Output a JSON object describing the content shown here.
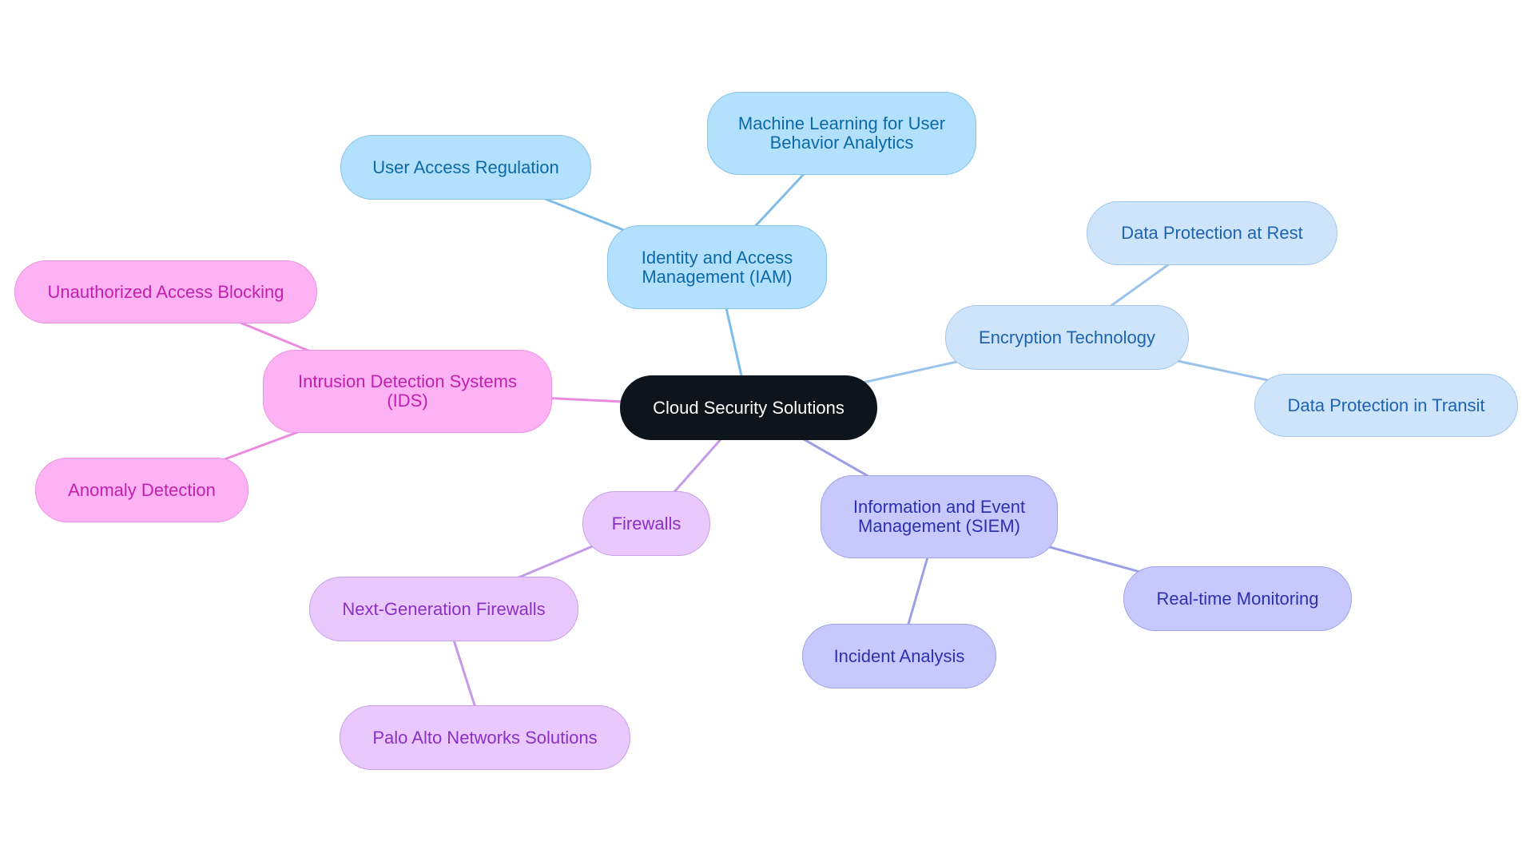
{
  "title": "Cloud Security Solutions",
  "colors": {
    "root": "#0d141c",
    "iam": "#7fbde8",
    "encryption": "#9bc3ea",
    "siem": "#9c9fe6",
    "firewalls": "#c59ae8",
    "ids": "#ea8be0"
  },
  "nodes": {
    "root": "Cloud Security Solutions",
    "iam": "Identity and Access\nManagement (IAM)",
    "iam_user_access": "User Access Regulation",
    "iam_ml": "Machine Learning for User\nBehavior Analytics",
    "enc": "Encryption Technology",
    "enc_rest": "Data Protection at Rest",
    "enc_transit": "Data Protection in Transit",
    "ids": "Intrusion Detection Systems\n(IDS)",
    "ids_unauth": "Unauthorized Access Blocking",
    "ids_anomaly": "Anomaly Detection",
    "fw": "Firewalls",
    "fw_ngfw": "Next-Generation Firewalls",
    "fw_palo": "Palo Alto Networks Solutions",
    "siem": "Information and Event\nManagement (SIEM)",
    "siem_realtime": "Real-time Monitoring",
    "siem_incident": "Incident Analysis"
  },
  "edges": [
    {
      "from": "root",
      "to": "iam",
      "branch": "iam"
    },
    {
      "from": "iam",
      "to": "iam_user_access",
      "branch": "iam"
    },
    {
      "from": "iam",
      "to": "iam_ml",
      "branch": "iam"
    },
    {
      "from": "root",
      "to": "enc",
      "branch": "encryption"
    },
    {
      "from": "enc",
      "to": "enc_rest",
      "branch": "encryption"
    },
    {
      "from": "enc",
      "to": "enc_transit",
      "branch": "encryption"
    },
    {
      "from": "root",
      "to": "ids",
      "branch": "ids"
    },
    {
      "from": "ids",
      "to": "ids_unauth",
      "branch": "ids"
    },
    {
      "from": "ids",
      "to": "ids_anomaly",
      "branch": "ids"
    },
    {
      "from": "root",
      "to": "fw",
      "branch": "firewalls"
    },
    {
      "from": "fw",
      "to": "fw_ngfw",
      "branch": "firewalls"
    },
    {
      "from": "fw_ngfw",
      "to": "fw_palo",
      "branch": "firewalls"
    },
    {
      "from": "root",
      "to": "siem",
      "branch": "siem"
    },
    {
      "from": "siem",
      "to": "siem_realtime",
      "branch": "siem"
    },
    {
      "from": "siem",
      "to": "siem_incident",
      "branch": "siem"
    }
  ]
}
